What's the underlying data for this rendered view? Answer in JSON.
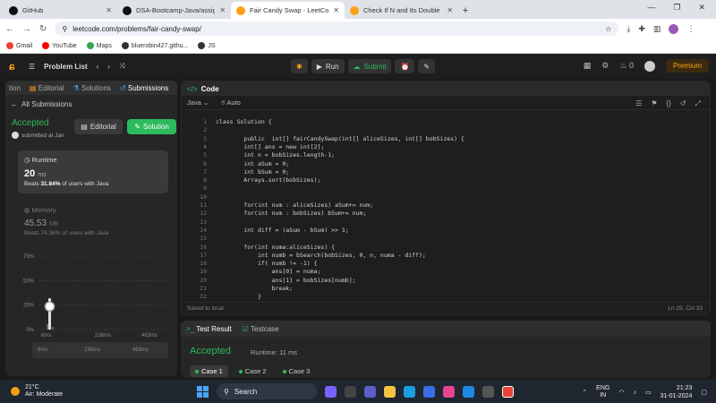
{
  "browser": {
    "tabs": [
      {
        "title": "GitHub",
        "color": "#111111",
        "active": false
      },
      {
        "title": "DSA-Bootcamp-Java/assignme",
        "color": "#111111",
        "active": false
      },
      {
        "title": "Fair Candy Swap - LeetCode",
        "color": "#ffa116",
        "active": true
      },
      {
        "title": "Check If N and Its Double Exist",
        "color": "#ffa116",
        "active": false
      }
    ],
    "url": "leetcode.com/problems/fair-candy-swap/",
    "bookmarks": [
      {
        "label": "Gmail",
        "color": "#ea4335"
      },
      {
        "label": "YouTube",
        "color": "#ff0000"
      },
      {
        "label": "Maps",
        "color": "#34a853"
      },
      {
        "label": "bluerobin427.githu...",
        "color": "#333333"
      },
      {
        "label": "JS",
        "color": "#333333"
      }
    ]
  },
  "lc": {
    "problem_list": "Problem List",
    "run": "Run",
    "submit": "Submit",
    "fire_count": "0",
    "premium": "Premium"
  },
  "left": {
    "tabs": [
      "tion",
      "Editorial",
      "Solutions",
      "Submissions"
    ],
    "all_submissions": "All Submissions",
    "accepted": "Accepted",
    "submitted_at": "submitted at Jan",
    "editorial_btn": "Editorial",
    "solution_btn": "Solution",
    "runtime_title": "Runtime",
    "runtime_value": "20",
    "runtime_unit": "ms",
    "runtime_beats_prefix": "Beats ",
    "runtime_beats_pct": "31.84%",
    "runtime_beats_suffix": " of users with Java",
    "memory_title": "Memory",
    "memory_value": "45.53",
    "memory_unit": "MB",
    "memory_beats": "Beats 74.36% of users with Java"
  },
  "chart_data": {
    "type": "bar",
    "yticks": [
      "75%",
      "50%",
      "25%",
      "0%"
    ],
    "ylim": [
      0,
      75
    ],
    "xticks": [
      "6ms",
      "236ms",
      "463ms"
    ],
    "highlight_x": "20ms",
    "highlight_y": 31.84,
    "slider_ticks": [
      "6ms",
      "236ms",
      "463ms"
    ]
  },
  "editor": {
    "title": "Code",
    "language": "Java",
    "mode": "Auto",
    "saved": "Saved to local",
    "cursor": "Ln 29, Col 33",
    "lines": [
      "class Solution {",
      "",
      "        public  int[] fairCandySwap(int[] aliceSizes, int[] bobSizes) {",
      "        int[] ans = new int[2];",
      "        int n = bobSizes.length-1;",
      "        int aSum = 0;",
      "        int bSum = 0;",
      "        Arrays.sort(bobSizes);",
      "",
      "",
      "        for(int num : aliceSizes) aSum+= num;",
      "        for(int num : bobSizes) bSum+= num;",
      "",
      "        int diff = (aSum - bSum) >> 1;",
      "",
      "        for(int numa:aliceSizes) {",
      "            int numb = bSearch(bobSizes, 0, n, numa - diff);",
      "            if( numb != -1) {",
      "                ans[0] = numa;",
      "                ans[1] = bobSizes[numb];",
      "                break;",
      "            }"
    ]
  },
  "test": {
    "result_tab": "Test Result",
    "testcase_tab": "Testcase",
    "accepted": "Accepted",
    "runtime": "Runtime: 11 ms",
    "cases": [
      "Case 1",
      "Case 2",
      "Case 3"
    ]
  },
  "taskbar": {
    "temp": "21°C",
    "weather": "Air: Moderate",
    "search": "Search",
    "lang1": "ENG",
    "lang2": "IN",
    "time": "21:23",
    "date": "31-01-2024"
  }
}
